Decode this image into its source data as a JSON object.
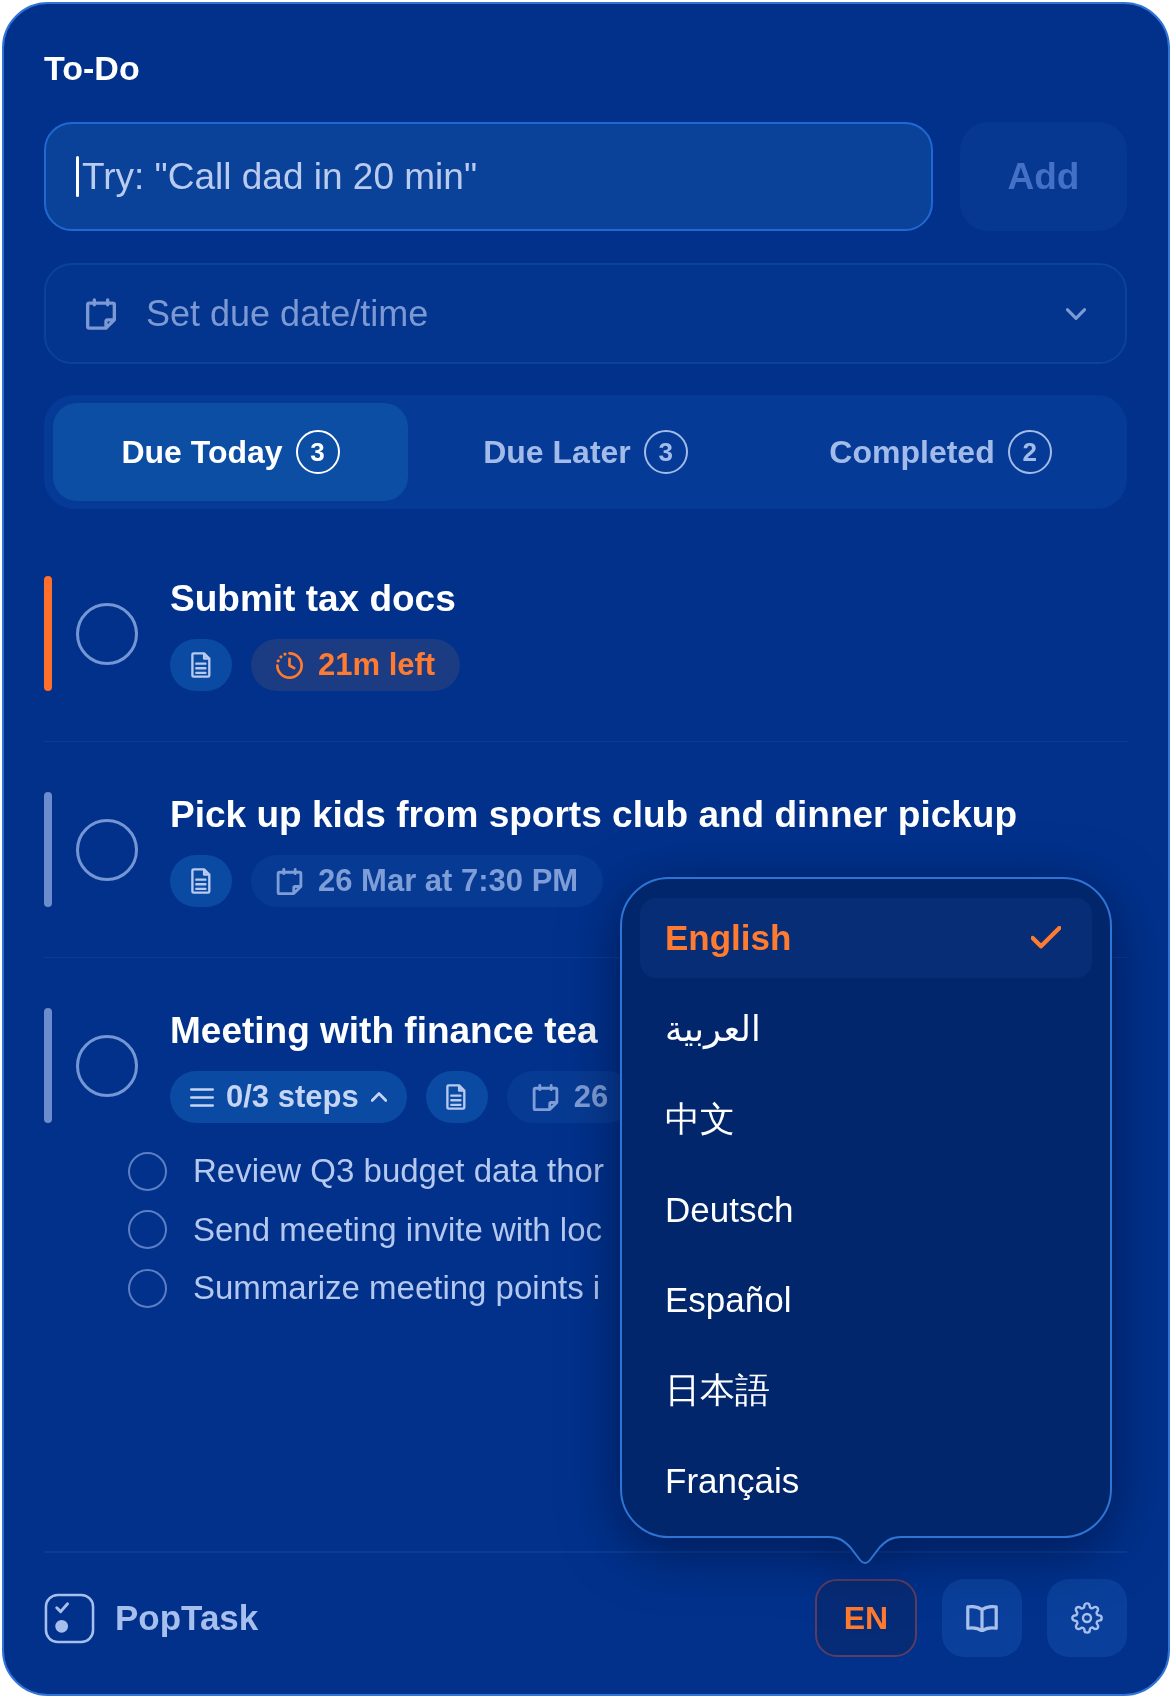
{
  "window": {
    "title": "To-Do"
  },
  "new_task": {
    "placeholder": "Try: \"Call dad in 20 min\"",
    "focused": true,
    "add_button": {
      "label": "Add",
      "disabled": true
    }
  },
  "due_picker": {
    "placeholder": "Set due date/time"
  },
  "tabs": [
    {
      "label": "Due Today",
      "count": "3",
      "selected": true
    },
    {
      "label": "Due Later",
      "count": "3",
      "selected": false
    },
    {
      "label": "Completed",
      "count": "2",
      "selected": false
    }
  ],
  "tasks": [
    {
      "title": "Submit tax docs",
      "completed": false,
      "color": "#ff6f2c",
      "chips": [
        {
          "kind": "notes"
        },
        {
          "kind": "countdown",
          "text": "21m left"
        }
      ]
    },
    {
      "title": "Pick up kids from sports club and dinner pickup",
      "completed": false,
      "color": "#6b8ccd",
      "chips": [
        {
          "kind": "notes"
        },
        {
          "kind": "due",
          "text": "26 Mar at 7:30 PM"
        }
      ]
    },
    {
      "title": "Meeting with finance tea",
      "completed": false,
      "color": "#6b8ccd",
      "chips": [
        {
          "kind": "steps",
          "text": "0/3 steps",
          "expanded": true
        },
        {
          "kind": "notes"
        },
        {
          "kind": "due",
          "text": "26"
        }
      ],
      "steps": [
        {
          "text": "Review Q3 budget data thor",
          "checked": false
        },
        {
          "text": "Send meeting invite with loc",
          "checked": false
        },
        {
          "text": "Summarize meeting points i",
          "checked": false
        }
      ]
    }
  ],
  "language_menu": {
    "open": true,
    "options": [
      {
        "label": "English",
        "selected": true
      },
      {
        "label": "العربية",
        "selected": false
      },
      {
        "label": "中文",
        "selected": false
      },
      {
        "label": "Deutsch",
        "selected": false
      },
      {
        "label": "Español",
        "selected": false
      },
      {
        "label": "日本語",
        "selected": false
      },
      {
        "label": "Français",
        "selected": false
      }
    ]
  },
  "footer": {
    "app_name": "PopTask",
    "language_button": {
      "label": "EN",
      "active": true
    }
  }
}
